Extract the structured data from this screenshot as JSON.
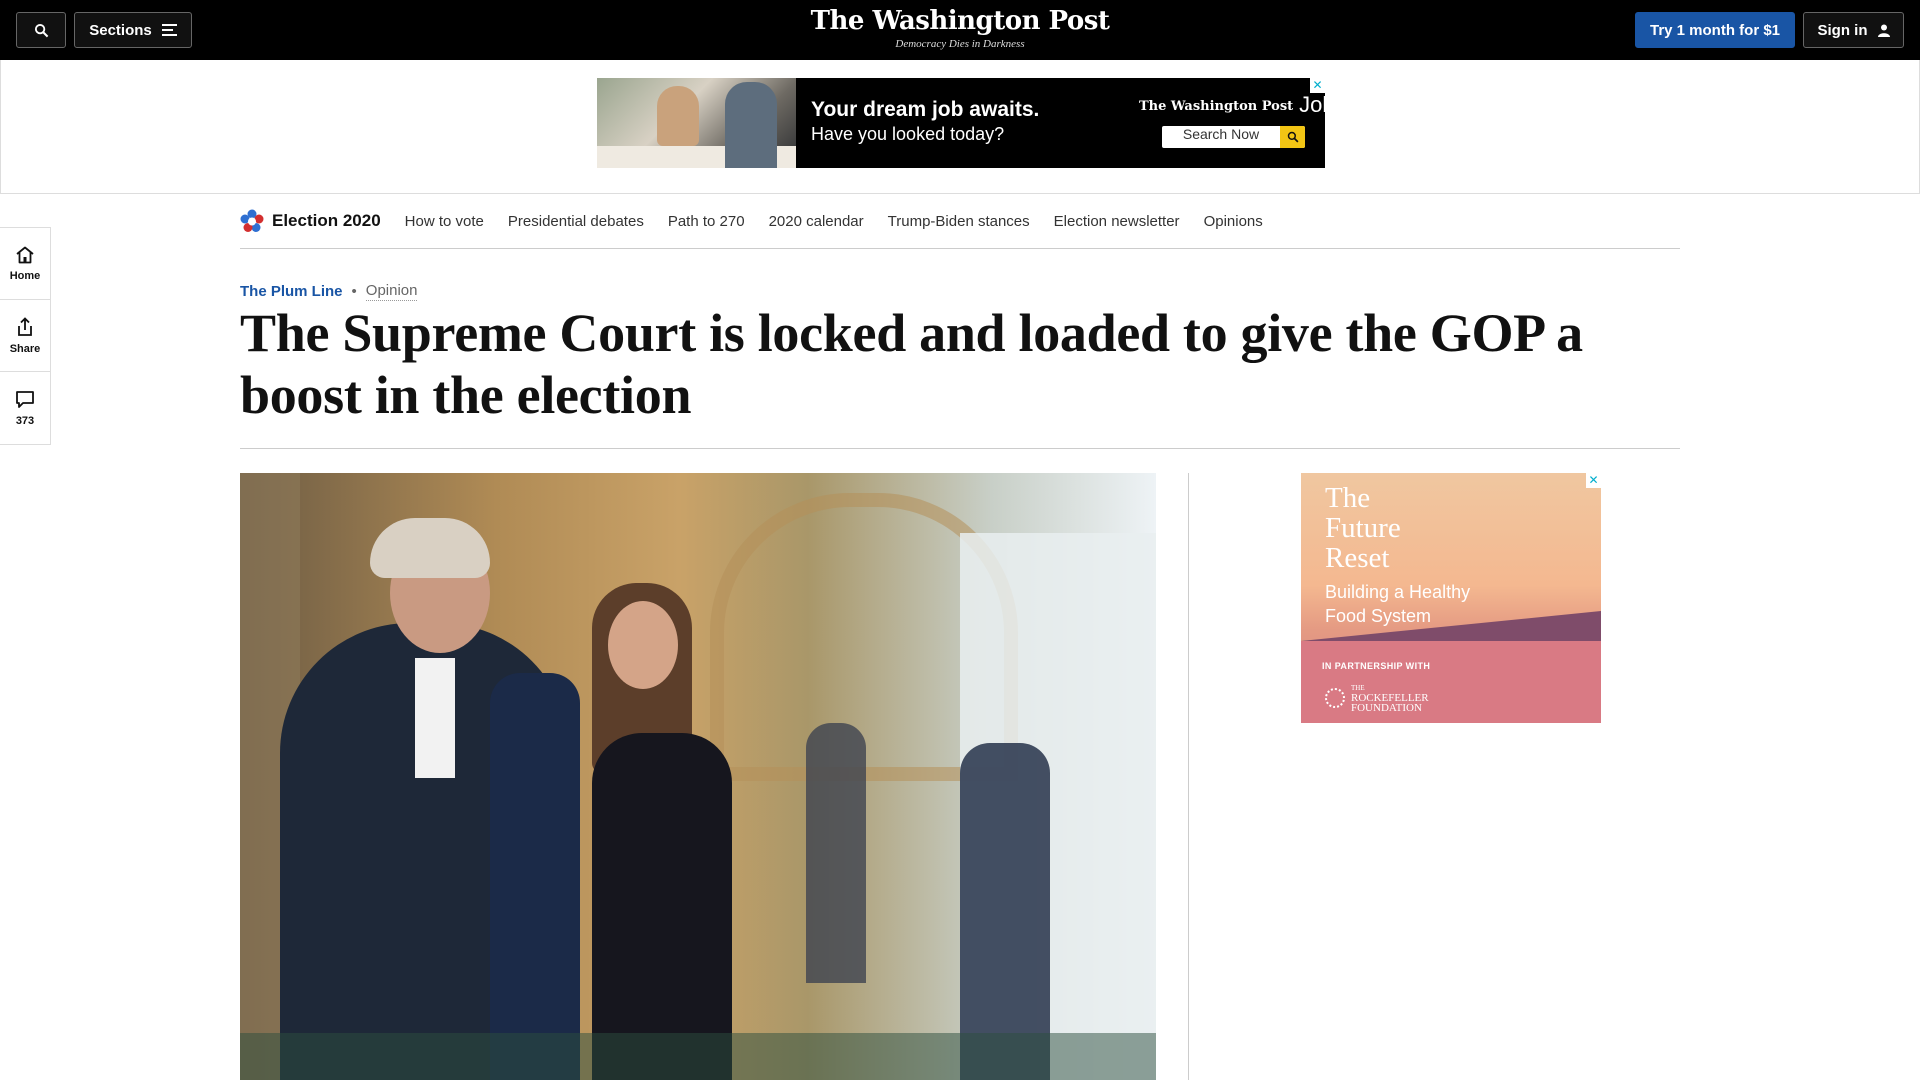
{
  "topbar": {
    "sections_label": "Sections",
    "masthead": "The Washington Post",
    "tagline": "Democracy Dies in Darkness",
    "subscribe_label": "Try 1 month for $1",
    "signin_label": "Sign in"
  },
  "top_ad": {
    "headline": "Your dream job awaits.",
    "subheadline": "Have you looked today?",
    "brand": "The Washington Post",
    "brand_suffix": "Jobs",
    "search_label": "Search Now",
    "close_glyph": "✕"
  },
  "election_nav": {
    "title": "Election 2020",
    "links": [
      "How to vote",
      "Presidential debates",
      "Path to 270",
      "2020 calendar",
      "Trump-Biden stances",
      "Election newsletter",
      "Opinions"
    ]
  },
  "left_rail": {
    "home_label": "Home",
    "share_label": "Share",
    "comments_count": "373"
  },
  "article": {
    "column": "The Plum Line",
    "separator": "•",
    "label": "Opinion",
    "headline": "The Supreme Court is locked and loaded to give the GOP a boost in the election"
  },
  "side_ad": {
    "title_line1": "The",
    "title_line2": "Future",
    "title_line3": "Reset",
    "subtitle_line1": "Building a Healthy",
    "subtitle_line2": "Food System",
    "partner_label": "IN PARTNERSHIP WITH",
    "foundation_line1": "THE",
    "foundation_line2": "ROCKEFELLER",
    "foundation_line3": "FOUNDATION",
    "close_glyph": "✕"
  },
  "colors": {
    "topbar_bg": "#000000",
    "subscribe_bg": "#1955a5",
    "column_link": "#1955a5",
    "search_button": "#f2c514"
  },
  "icons": [
    "search-icon",
    "hamburger-icon",
    "user-icon",
    "election-star-icon",
    "home-icon",
    "share-icon",
    "comment-icon",
    "magnifier-icon",
    "close-icon"
  ]
}
